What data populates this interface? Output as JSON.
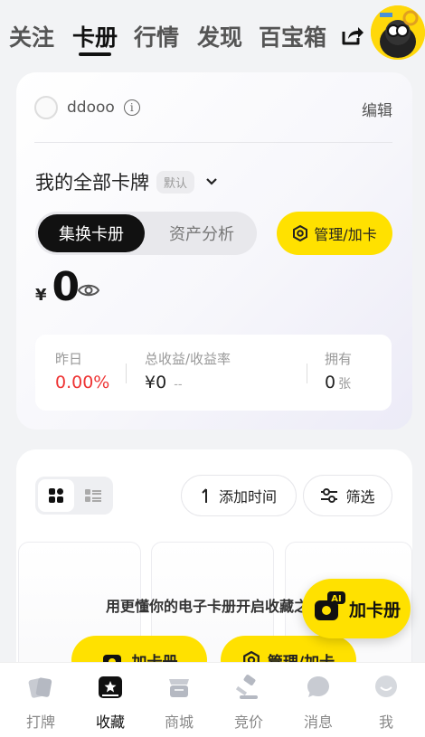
{
  "top_tabs": [
    {
      "label": "关注"
    },
    {
      "label": "卡册"
    },
    {
      "label": "行情"
    },
    {
      "label": "发现"
    },
    {
      "label": "百宝箱"
    }
  ],
  "active_tab": "卡册",
  "user": {
    "name": "ddooo",
    "info": "i"
  },
  "header": {
    "edit_label": "编辑"
  },
  "collection": {
    "title": "我的全部卡牌",
    "default_badge": "默认",
    "chevron": "⌄"
  },
  "segments": {
    "active": "集换卡册",
    "other": "资产分析"
  },
  "manage_button": "管理/加卡",
  "balance": {
    "currency": "¥",
    "value": "0"
  },
  "stats": [
    {
      "label": "昨日",
      "value": "0.00%"
    },
    {
      "label": "总收益/收益率",
      "value": "¥0",
      "extra": "--"
    },
    {
      "label": "拥有",
      "value": "0",
      "unit": "张"
    }
  ],
  "filters": {
    "sort_label": "添加时间",
    "filter_label": "筛选"
  },
  "empty_state": {
    "text": "用更懂你的电子卡册开启收藏之旅"
  },
  "cta_buttons": [
    {
      "label": "加卡册"
    },
    {
      "label": "管理/加卡"
    }
  ],
  "fab": {
    "label": "加卡册",
    "badge": "AI"
  },
  "bottom_nav": [
    {
      "label": "打牌",
      "icon": "cards-icon"
    },
    {
      "label": "收藏",
      "icon": "album-icon"
    },
    {
      "label": "商城",
      "icon": "shop-icon"
    },
    {
      "label": "竞价",
      "icon": "auction-icon"
    },
    {
      "label": "消息",
      "icon": "message-icon"
    },
    {
      "label": "我",
      "icon": "profile-icon"
    }
  ],
  "colors": {
    "accent": "#ffe100",
    "dark": "#111111",
    "negative": "#e33333"
  }
}
